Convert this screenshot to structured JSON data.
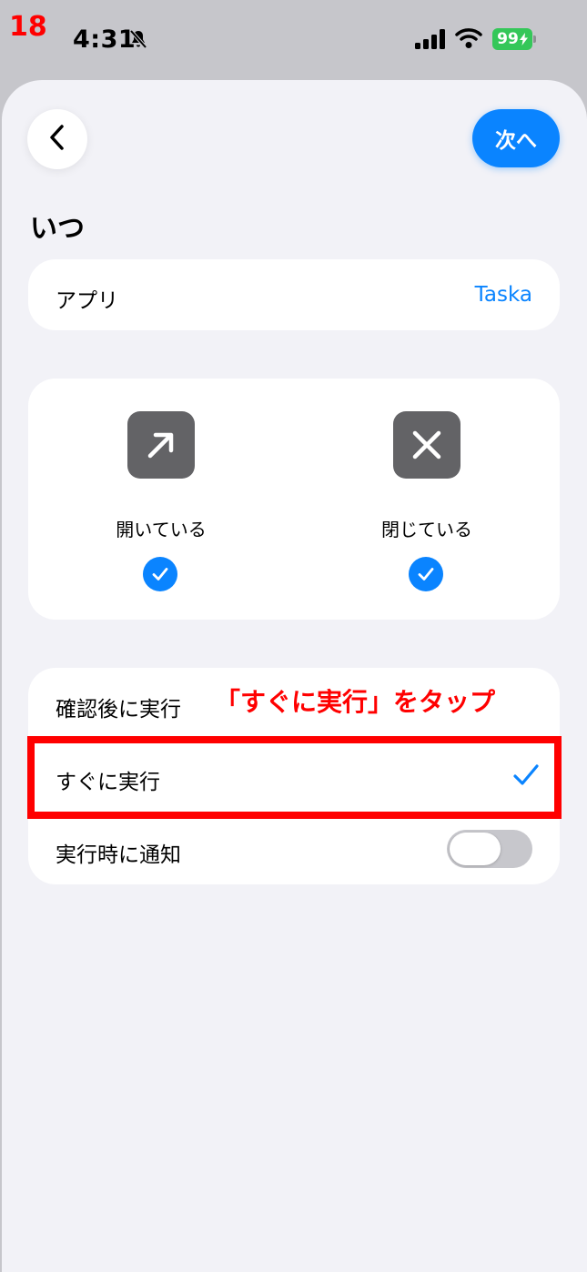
{
  "step_number": "18",
  "status_bar": {
    "time": "4:31",
    "battery": "99",
    "icons": [
      "bell-slash-icon",
      "signal-icon",
      "wifi-icon",
      "battery-charging-icon"
    ]
  },
  "nav": {
    "back_icon": "chevron-left-icon",
    "next_label": "次へ"
  },
  "section_title": "いつ",
  "app_row": {
    "label": "アプリ",
    "value": "Taska"
  },
  "states": [
    {
      "label": "開いている",
      "icon": "arrow-up-right-icon",
      "checked": true
    },
    {
      "label": "閉じている",
      "icon": "xmark-icon",
      "checked": true
    }
  ],
  "run_options": [
    {
      "label": "確認後に実行"
    },
    {
      "label": "すぐに実行",
      "selected": true
    },
    {
      "label": "実行時に通知",
      "toggle": false
    }
  ],
  "annotation": "「すぐに実行」をタップ",
  "colors": {
    "accent": "#0a84ff",
    "annotation": "#ff0000",
    "battery": "#34c759",
    "icon_box": "#636366"
  }
}
